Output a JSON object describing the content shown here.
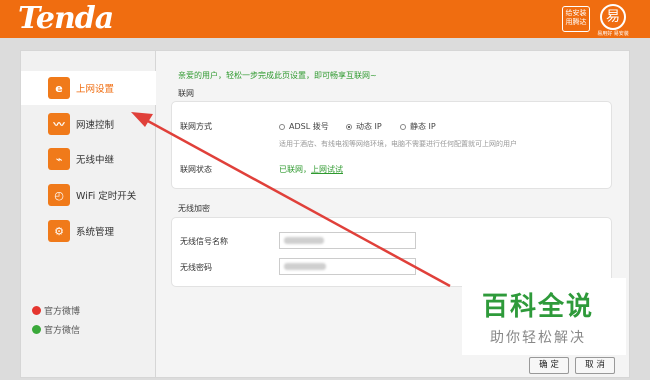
{
  "header": {
    "logo": "Tenda",
    "badge": "给安装用腾达",
    "circle_glyph": "易",
    "circle_sub": "易用好 易安装"
  },
  "sidebar": {
    "items": [
      {
        "label": "上网设置",
        "icon": "e-icon",
        "glyph": "e"
      },
      {
        "label": "网速控制",
        "icon": "speed-wave-icon",
        "glyph": "〰"
      },
      {
        "label": "无线中继",
        "icon": "wireless-relay-icon",
        "glyph": "⌁"
      },
      {
        "label": "WiFi 定时开关",
        "icon": "wifi-timer-icon",
        "glyph": "◴"
      },
      {
        "label": "系统管理",
        "icon": "gear-icon",
        "glyph": "⚙"
      }
    ],
    "social": [
      {
        "label": "官方微博",
        "icon": "weibo-icon"
      },
      {
        "label": "官方微信",
        "icon": "wechat-icon"
      }
    ]
  },
  "main": {
    "welcome": "亲爱的用户，轻松一步完成此页设置，即可畅享互联网~",
    "internet_section": "联网",
    "connection_label": "联网方式",
    "options": [
      "ADSL 拨号",
      "动态 IP",
      "静态 IP"
    ],
    "selected_option": "动态 IP",
    "hint": "适用于酒店、有线电视等网络环境，电脑不需要进行任何配置就可上网的用户",
    "status_label": "联网状态",
    "status_value": "已联网，",
    "status_link": "上网试试",
    "wireless_section": "无线加密",
    "ssid_label": "无线信号名称",
    "password_label": "无线密码"
  },
  "buttons": {
    "ok": "确 定",
    "cancel": "取 消"
  },
  "watermark": {
    "title": "百科全说",
    "subtitle": "助你轻松解决"
  },
  "colors": {
    "brand_orange": "#f06d10",
    "green_text": "#2f9a2f",
    "arrow_red": "#e0403a"
  }
}
